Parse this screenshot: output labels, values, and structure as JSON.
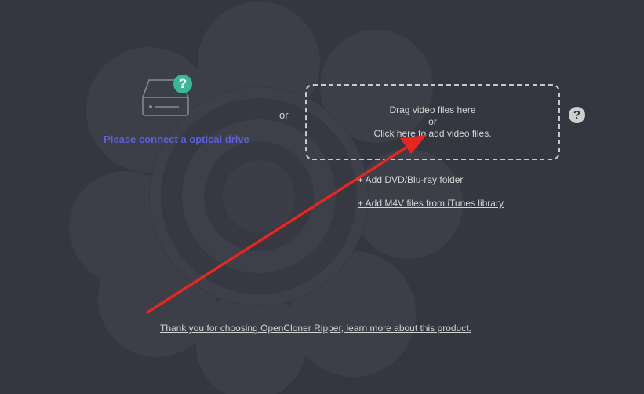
{
  "drive": {
    "icon": "optical-drive-icon",
    "help_glyph": "?",
    "help_color": "#3ab79a",
    "connect_label": "Please connect a optical drive",
    "connect_label_color": "#5c5ede"
  },
  "separator": {
    "or_label": "or"
  },
  "drop_zone": {
    "line1": "Drag video files here",
    "line2": "or",
    "line3": "Click here to add video files.",
    "help_glyph": "?"
  },
  "links": {
    "add_folder": "+ Add DVD/Blu-ray folder",
    "add_m4v": "+ Add M4V files from iTunes library"
  },
  "footer": {
    "thanks_link": "Thank you for choosing OpenCloner Ripper, learn more about this product."
  },
  "annotation": {
    "arrow_color": "#e8261f"
  },
  "theme": {
    "background": "#343740",
    "logo_shape_color": "#3b3e47"
  }
}
